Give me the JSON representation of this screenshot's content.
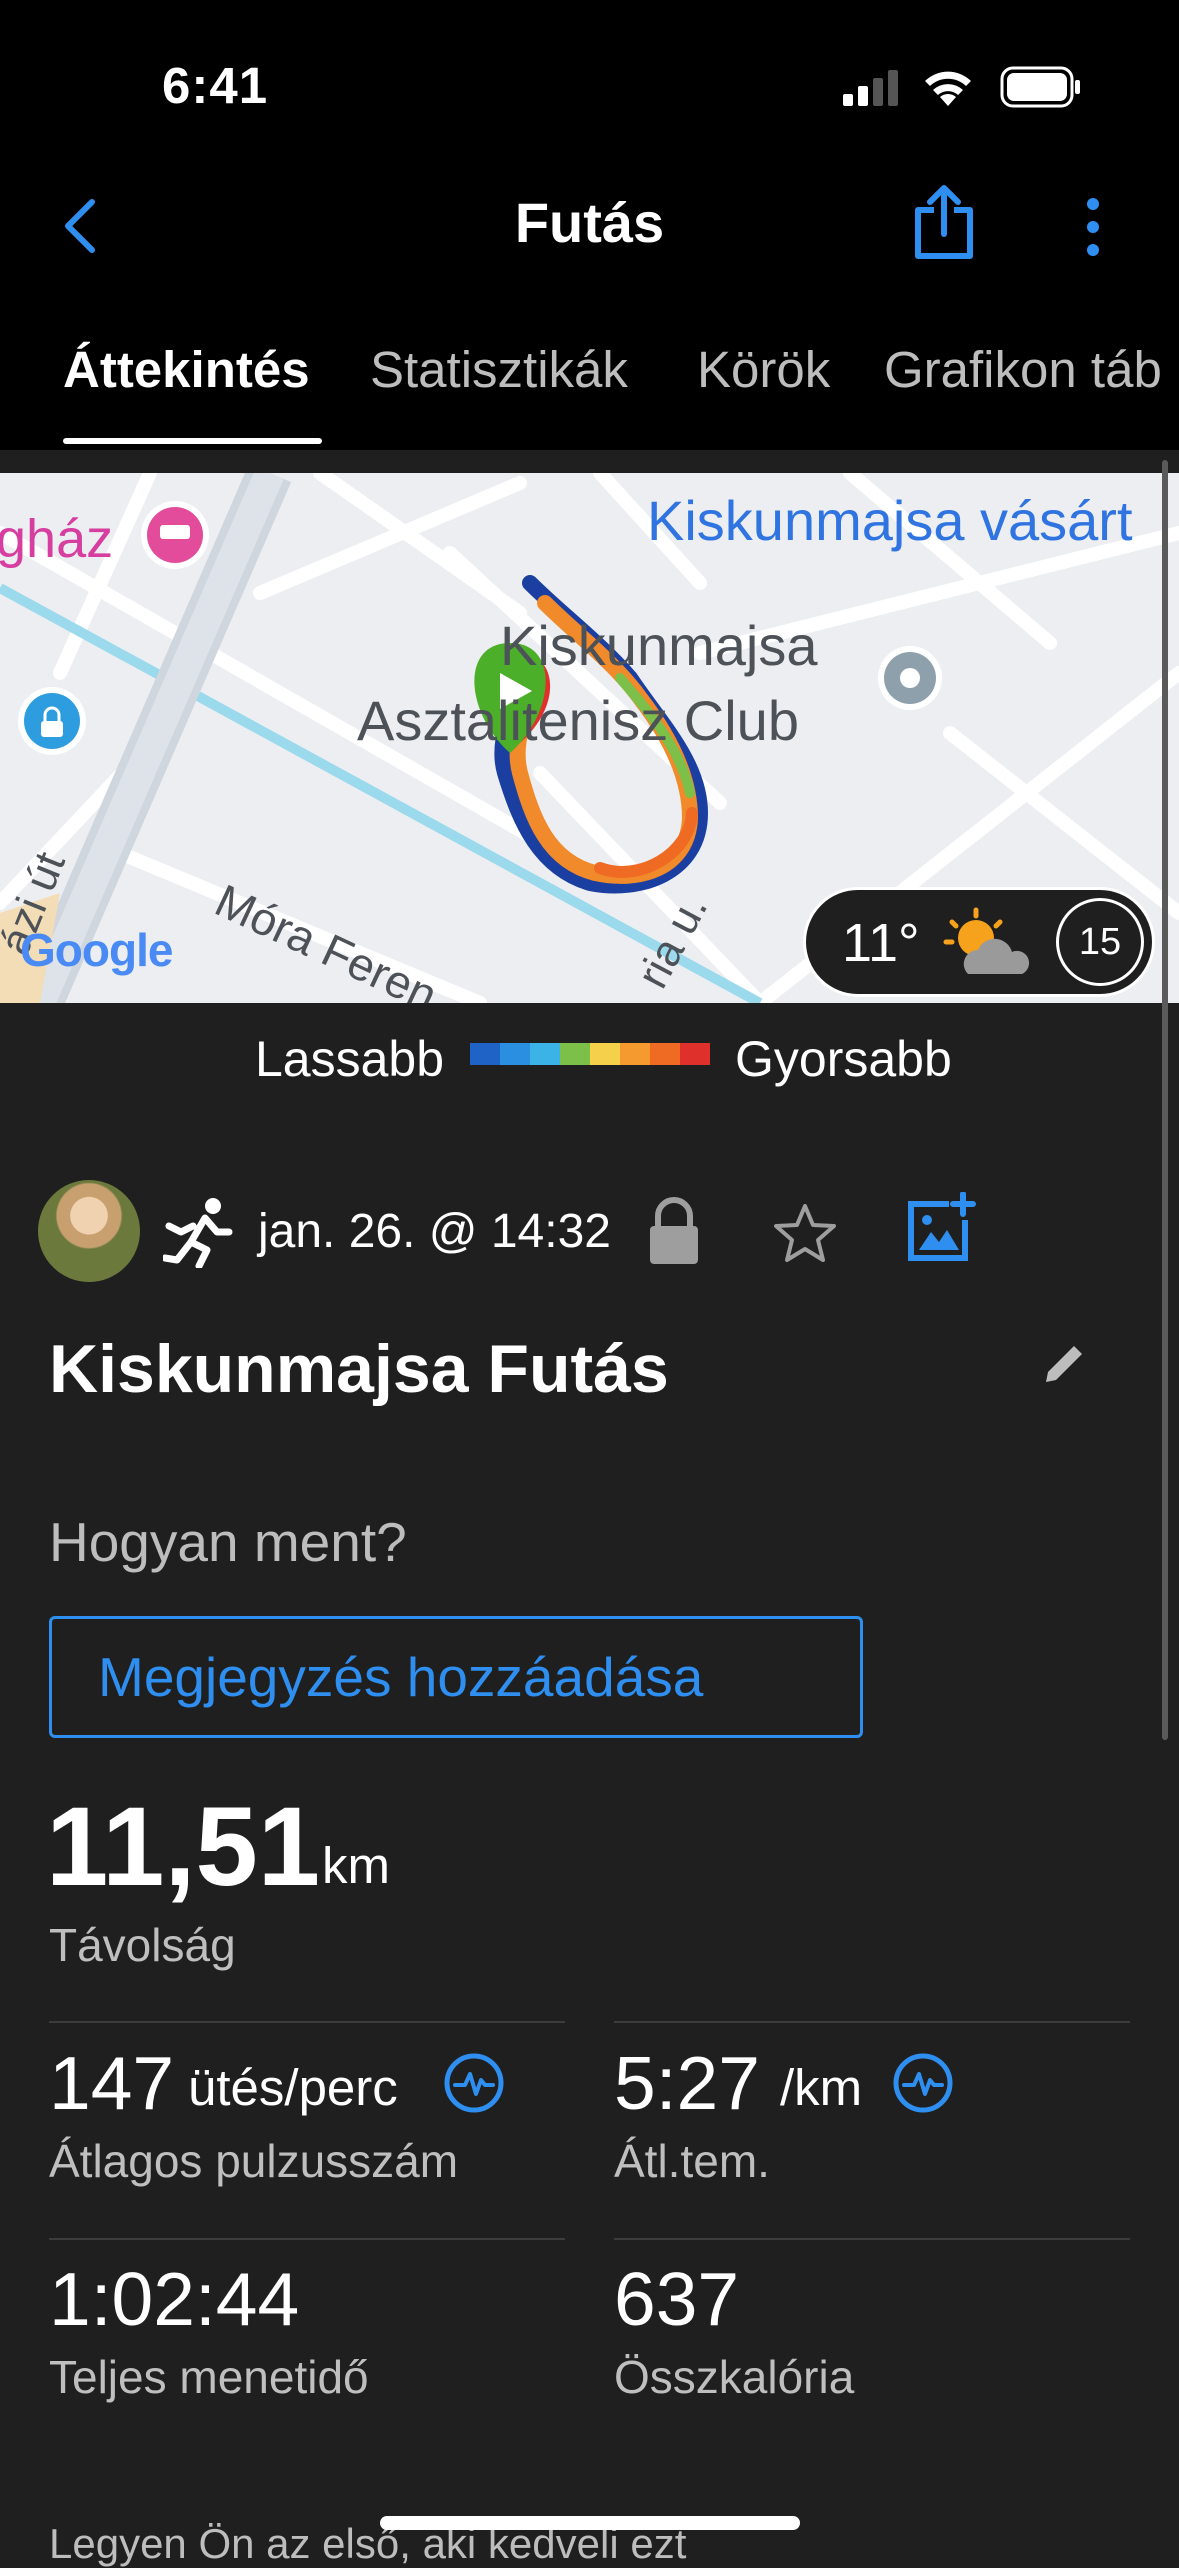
{
  "status_bar": {
    "time": "6:41"
  },
  "header": {
    "title": "Futás"
  },
  "tabs": [
    {
      "label": "Áttekintés"
    },
    {
      "label": "Statisztikák"
    },
    {
      "label": "Körök"
    },
    {
      "label": "Grafikon táb"
    }
  ],
  "map": {
    "labels": {
      "place_left": "gház",
      "market": "Kiskunmajsa vásárt",
      "club_line1": "Kiskunmajsa",
      "club_line2": "Asztalitenisz Club",
      "street_mora": "Móra Feren",
      "street_left": "ázi út",
      "street_right": "ria u."
    },
    "google_logo": "Google",
    "weather": {
      "temperature": "11°",
      "wind": "15",
      "icon": "partly-sunny-icon"
    }
  },
  "legend": {
    "slower": "Lassabb",
    "faster": "Gyorsabb",
    "colors": [
      "#1f63c6",
      "#2a8fe0",
      "#3bb3e6",
      "#7cc04a",
      "#f5d04a",
      "#f59a2f",
      "#ef6b23",
      "#e0302b"
    ]
  },
  "activity": {
    "datetime": "jan. 26. @ 14:32",
    "name": "Kiskunmajsa Futás",
    "prompt": "Hogyan ment?",
    "add_note_button": "Megjegyzés hozzáadása"
  },
  "stats": {
    "distance": {
      "value": "11,51",
      "unit": "km",
      "label": "Távolság"
    },
    "avg_hr": {
      "value": "147",
      "unit": "ütés/perc",
      "label": "Átlagos pulzusszám"
    },
    "avg_pace": {
      "value": "5:27",
      "unit": "/km",
      "label": "Átl.tem."
    },
    "total_time": {
      "value": "1:02:44",
      "label": "Teljes menetidő"
    },
    "calories": {
      "value": "637",
      "label": "Összkalória"
    }
  },
  "footer_text": "Legyen Ön az első, aki kedveli ezt",
  "accent_color": "#2e8ff0"
}
